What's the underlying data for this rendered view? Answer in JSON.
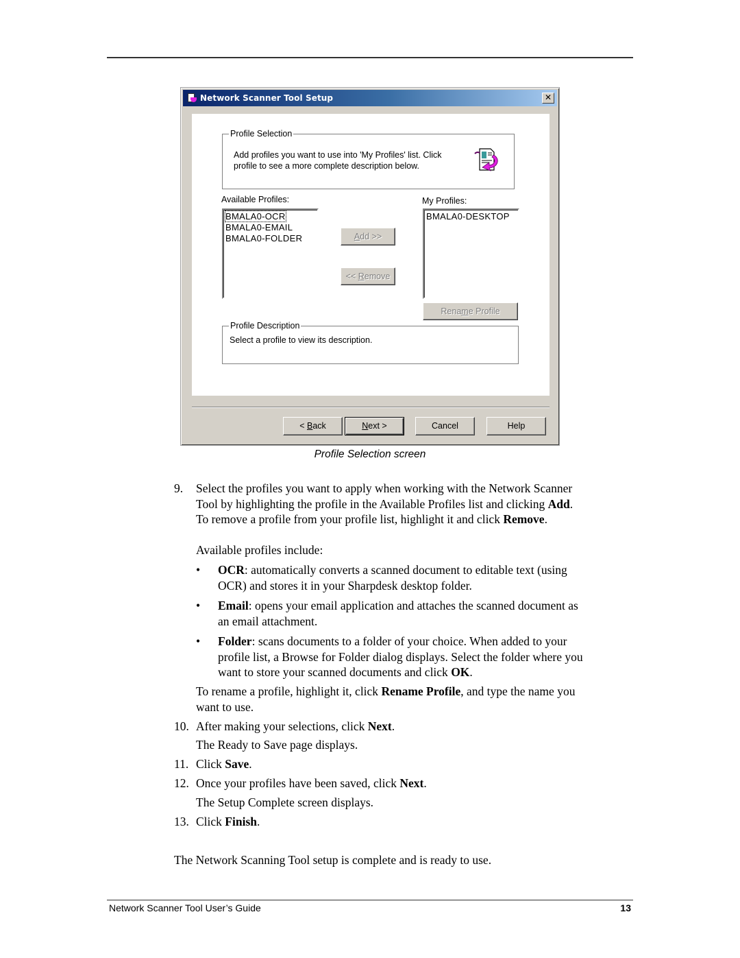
{
  "dialog": {
    "title": "Network Scanner Tool Setup",
    "close_label": "✕",
    "profile_selection": {
      "group_label": "Profile Selection",
      "instructions": "Add profiles you want to use into 'My Profiles' list. Click profile to see a more complete description below."
    },
    "available_profiles": {
      "label": "Available Profiles:",
      "items": [
        "BMALA0-OCR",
        "BMALA0-EMAIL",
        "BMALA0-FOLDER"
      ],
      "focused_index": 0
    },
    "my_profiles": {
      "label": "My Profiles:",
      "items": [
        "BMALA0-DESKTOP"
      ]
    },
    "buttons": {
      "add": {
        "pre": "",
        "ul": "A",
        "post": "dd >>",
        "enabled": false
      },
      "remove": {
        "pre": "<< ",
        "ul": "R",
        "post": "emove",
        "enabled": false
      },
      "rename": {
        "pre": "Rena",
        "ul": "m",
        "post": "e Profile",
        "enabled": false
      }
    },
    "profile_description": {
      "group_label": "Profile Description",
      "text": "Select a profile to view its description."
    },
    "nav": {
      "back": {
        "pre": "< ",
        "ul": "B",
        "post": "ack"
      },
      "next": {
        "pre": "",
        "ul": "N",
        "post": "ext >"
      },
      "cancel": "Cancel",
      "help": "Help"
    }
  },
  "caption": "Profile Selection screen",
  "steps": {
    "s9": {
      "num": "9.",
      "line1": "Select the profiles you want to apply when working with the Network Scanner",
      "line2a": "Tool by highlighting the profile in the Available Profiles list and clicking ",
      "line2b": "Add",
      "line2c": ".",
      "line3a": "To remove a profile from your profile list, highlight it and click ",
      "line3b": "Remove",
      "line3c": "."
    },
    "available_intro": "Available profiles include:",
    "bullets": [
      {
        "term": "OCR",
        "line1": ": automatically converts a scanned document to editable text (using",
        "line2": "OCR) and stores it in your Sharpdesk desktop folder."
      },
      {
        "term": "Email",
        "line1": ": opens your email application and attaches the scanned document as",
        "line2": "an email attachment."
      },
      {
        "term": "Folder",
        "line1": ": scans documents to a folder of your choice. When added to your",
        "line2": "profile list, a Browse for Folder dialog displays. Select the folder where you",
        "line3a": "want to store your scanned documents and click ",
        "line3b": "OK",
        "line3c": "."
      }
    ],
    "rename": {
      "a": "To rename a profile, highlight it, click ",
      "b": "Rename Profile",
      "c": ", and type the name you",
      "line2": "want to use."
    },
    "s10": {
      "num": "10.",
      "a": "After making your selections, click ",
      "b": "Next",
      "c": ".",
      "sub": "The Ready to Save page displays."
    },
    "s11": {
      "num": "11.",
      "a": "Click ",
      "b": "Save",
      "c": "."
    },
    "s12": {
      "num": "12.",
      "a": "Once your profiles have been saved, click ",
      "b": "Next",
      "c": ".",
      "sub": "The Setup Complete screen displays."
    },
    "s13": {
      "num": "13.",
      "a": "Click ",
      "b": "Finish",
      "c": "."
    },
    "closing": "The Network Scanning Tool setup is complete and is ready to use."
  },
  "footer": {
    "title": "Network Scanner Tool User’s Guide",
    "page": "13"
  },
  "bullet_glyph": "•"
}
